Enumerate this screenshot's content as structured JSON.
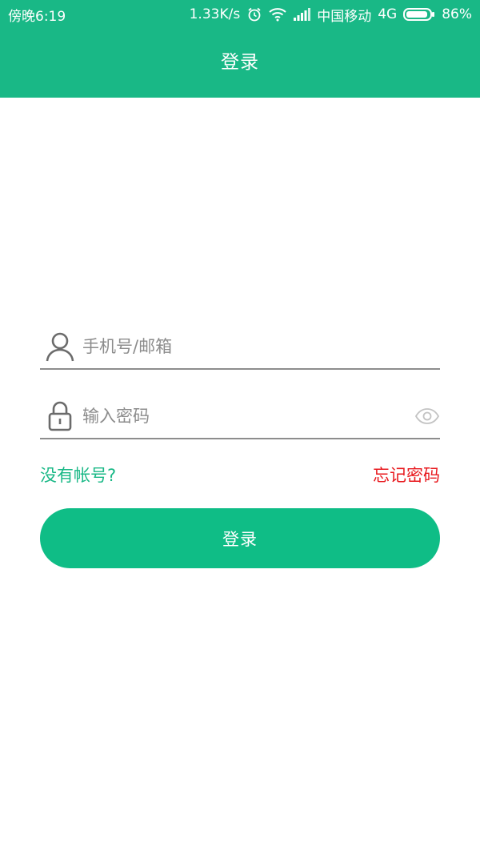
{
  "status_bar": {
    "time": "傍晚6:19",
    "network_speed": "1.33K/s",
    "carrier": "中国移动",
    "network_type": "4G",
    "battery": "86%"
  },
  "header": {
    "title": "登录",
    "background_color": "#19b886"
  },
  "login_form": {
    "username_placeholder": "手机号/邮箱",
    "username_value": "",
    "password_placeholder": "输入密码",
    "password_value": "",
    "register_link": "没有帐号?",
    "forgot_link": "忘记密码",
    "submit_label": "登录"
  },
  "icons": {
    "user": "user-icon",
    "lock": "lock-icon",
    "eye": "eye-icon",
    "alarm": "alarm-icon",
    "wifi": "wifi-icon",
    "signal": "signal-icon",
    "battery": "battery-icon"
  },
  "colors": {
    "accent": "#19b886",
    "button": "#0fbd86",
    "forgot": "#e8191e"
  }
}
